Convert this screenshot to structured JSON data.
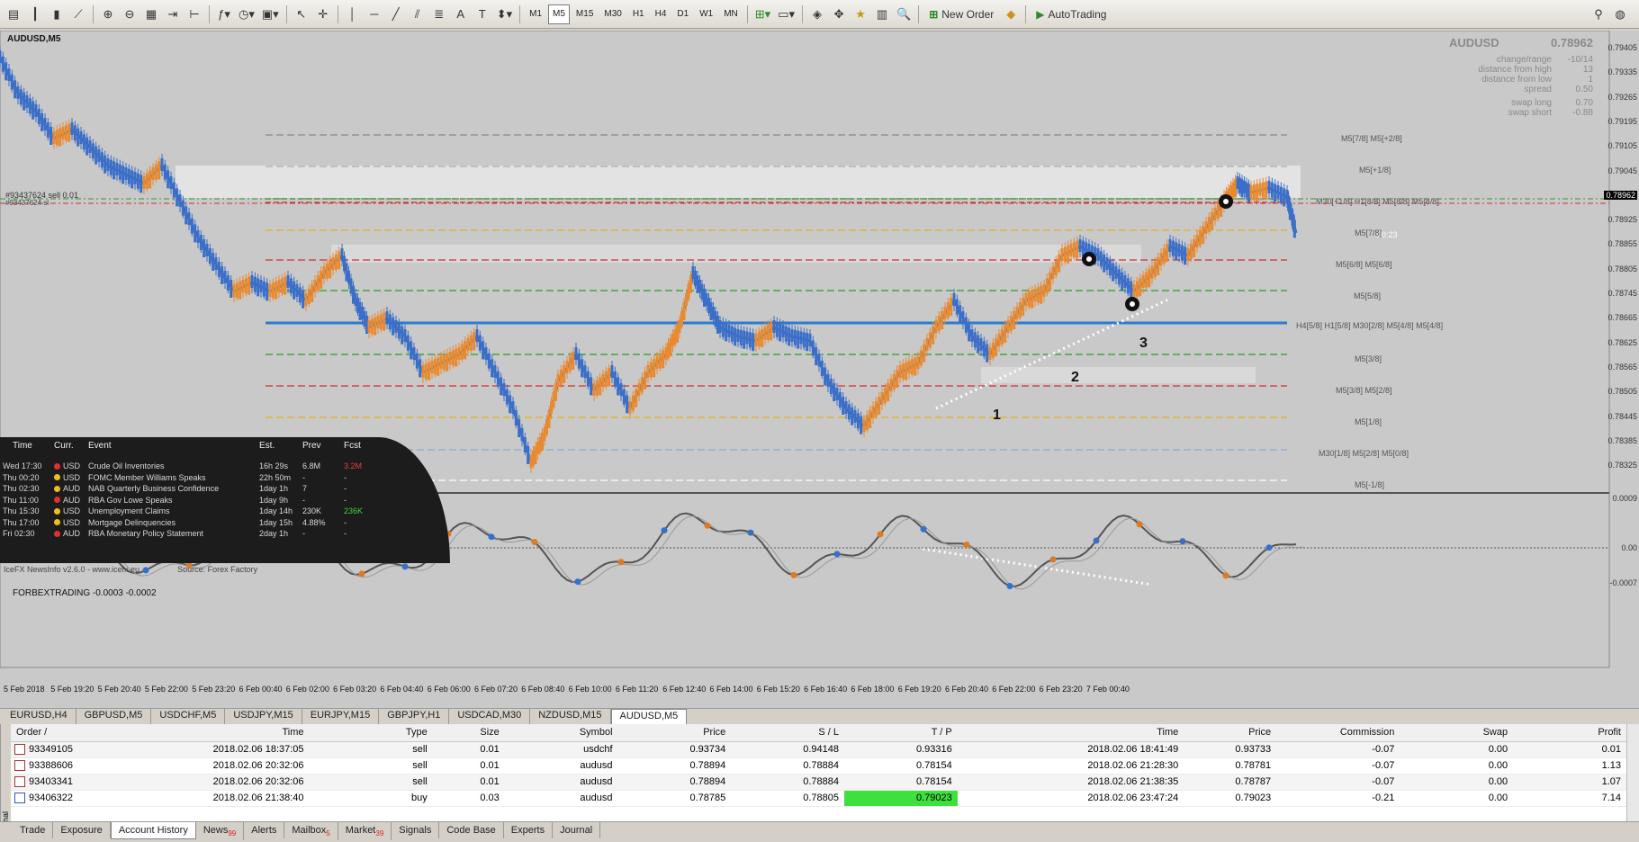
{
  "toolbar": {
    "timeframes": [
      "M1",
      "M5",
      "M15",
      "M30",
      "H1",
      "H4",
      "D1",
      "W1",
      "MN"
    ],
    "active_timeframe": "M5",
    "new_order_label": "New Order",
    "autotrading_label": "AutoTrading"
  },
  "chart": {
    "symbol_title": "AUDUSD,M5",
    "order_line_label": "#93437624 sell 0.01",
    "order_line_label2": "#93437624 sl",
    "price_axis": [
      "0.79405",
      "0.79335",
      "0.79265",
      "0.79195",
      "0.79105",
      "0.79045",
      "0.78962",
      "0.78925",
      "0.78855",
      "0.78805",
      "0.78745",
      "0.78665",
      "0.78625",
      "0.78565",
      "0.78505",
      "0.78445",
      "0.78385",
      "0.78325"
    ],
    "current_price": "0.78962",
    "countdown": "00:23",
    "info_box": {
      "symbol": "AUDUSD",
      "price": "0.78962",
      "rows": [
        {
          "label": "change/range",
          "value": "-10/14"
        },
        {
          "label": "distance from high",
          "value": "13"
        },
        {
          "label": "distance from low",
          "value": "1"
        },
        {
          "label": "spread",
          "value": "0.50"
        },
        {
          "label": "swap long",
          "value": "0.70"
        },
        {
          "label": "swap short",
          "value": "-0.88"
        }
      ]
    },
    "level_labels": [
      "M5[7/8] M5[+2/8]",
      "M5[+1/8]",
      "M30[+1/8] H1[8/8] M5[8/8] M5[8/8]",
      "M5[7/8]",
      "M5[6/8] M5[6/8]",
      "M5[5/8]",
      "H4[5/8] H1[5/8] M30[2/8] M5[4/8] M5[4/8]",
      "M5[3/8]",
      "M5[3/8] M5[2/8]",
      "M5[1/8]",
      "M30[1/8] M5[2/8] M5[0/8]",
      "M5[-1/8]"
    ],
    "annotations": [
      "1",
      "2",
      "3"
    ],
    "oscillator": {
      "title": "FORBEXTRADING -0.0003 -0.0002",
      "axis": [
        "0.0009",
        "0.00",
        "-0.0007"
      ]
    },
    "time_axis": [
      "5 Feb 2018",
      "5 Feb 19:20",
      "5 Feb 20:40",
      "5 Feb 22:00",
      "5 Feb 23:20",
      "6 Feb 00:40",
      "6 Feb 02:00",
      "6 Feb 03:20",
      "6 Feb 04:40",
      "6 Feb 06:00",
      "6 Feb 07:20",
      "6 Feb 08:40",
      "6 Feb 10:00",
      "6 Feb 11:20",
      "6 Feb 12:40",
      "6 Feb 14:00",
      "6 Feb 15:20",
      "6 Feb 16:40",
      "6 Feb 18:00",
      "6 Feb 19:20",
      "6 Feb 20:40",
      "6 Feb 22:00",
      "6 Feb 23:20",
      "7 Feb 00:40"
    ]
  },
  "news": {
    "headers": {
      "time": "Time",
      "curr": "Curr.",
      "event": "Event",
      "est": "Est.",
      "prev": "Prev",
      "fcst": "Fcst"
    },
    "rows": [
      {
        "time": "Wed 17:30",
        "curr": "USD",
        "color": "#e03030",
        "event": "Crude Oil Inventories",
        "est": "16h 29s",
        "prev": "6.8M",
        "fcst": "3.2M"
      },
      {
        "time": "Thu 00:20",
        "curr": "USD",
        "color": "#e8c020",
        "event": "FOMC Member Williams Speaks",
        "est": "22h 50m",
        "prev": "-",
        "fcst": "-"
      },
      {
        "time": "Thu 02:30",
        "curr": "AUD",
        "color": "#e8c020",
        "event": "NAB Quarterly Business Confidence",
        "est": "1day 1h",
        "prev": "7",
        "fcst": "-"
      },
      {
        "time": "Thu 11:00",
        "curr": "AUD",
        "color": "#e03030",
        "event": "RBA Gov Lowe Speaks",
        "est": "1day 9h",
        "prev": "-",
        "fcst": "-"
      },
      {
        "time": "Thu 15:30",
        "curr": "USD",
        "color": "#e8c020",
        "event": "Unemployment Claims",
        "est": "1day 14h",
        "prev": "230K",
        "fcst": "236K"
      },
      {
        "time": "Thu 17:00",
        "curr": "USD",
        "color": "#e8c020",
        "event": "Mortgage Delinquencies",
        "est": "1day 15h",
        "prev": "4.88%",
        "fcst": "-"
      },
      {
        "time": "Fri 02:30",
        "curr": "AUD",
        "color": "#e03030",
        "event": "RBA Monetary Policy Statement",
        "est": "2day 1h",
        "prev": "-",
        "fcst": "-"
      }
    ],
    "footer_left": "IceFX NewsInfo v2.6.0 - www.icefx.eu",
    "footer_right": "Source: Forex Factory"
  },
  "symbol_tabs": [
    "EURUSD,H4",
    "GBPUSD,M5",
    "USDCHF,M5",
    "USDJPY,M15",
    "EURJPY,M15",
    "GBPJPY,H1",
    "USDCAD,M30",
    "NZDUSD,M15",
    "AUDUSD,M5"
  ],
  "active_symbol_tab": "AUDUSD,M5",
  "orders": {
    "headers": [
      "Order",
      "Time",
      "Type",
      "Size",
      "Symbol",
      "Price",
      "S / L",
      "T / P",
      "Time",
      "Price",
      "Commission",
      "Swap",
      "Profit"
    ],
    "rows": [
      {
        "order": "93349105",
        "open_time": "2018.02.06 18:37:05",
        "type": "sell",
        "size": "0.01",
        "symbol": "usdchf",
        "price": "0.93734",
        "sl": "0.94148",
        "tp": "0.93316",
        "close_time": "2018.02.06 18:41:49",
        "close_price": "0.93733",
        "commission": "-0.07",
        "swap": "0.00",
        "profit": "0.01"
      },
      {
        "order": "93388606",
        "open_time": "2018.02.06 20:32:06",
        "type": "sell",
        "size": "0.01",
        "symbol": "audusd",
        "price": "0.78894",
        "sl": "0.78884",
        "tp": "0.78154",
        "close_time": "2018.02.06 21:28:30",
        "close_price": "0.78781",
        "commission": "-0.07",
        "swap": "0.00",
        "profit": "1.13"
      },
      {
        "order": "93403341",
        "open_time": "2018.02.06 20:32:06",
        "type": "sell",
        "size": "0.01",
        "symbol": "audusd",
        "price": "0.78894",
        "sl": "0.78884",
        "tp": "0.78154",
        "close_time": "2018.02.06 21:38:35",
        "close_price": "0.78787",
        "commission": "-0.07",
        "swap": "0.00",
        "profit": "1.07"
      },
      {
        "order": "93406322",
        "open_time": "2018.02.06 21:38:40",
        "type": "buy",
        "size": "0.03",
        "symbol": "audusd",
        "price": "0.78785",
        "sl": "0.78805",
        "tp": "0.79023",
        "close_time": "2018.02.06 23:47:24",
        "close_price": "0.79023",
        "commission": "-0.21",
        "swap": "0.00",
        "profit": "7.14"
      }
    ]
  },
  "bottom_tabs": [
    {
      "label": "Trade",
      "badge": ""
    },
    {
      "label": "Exposure",
      "badge": ""
    },
    {
      "label": "Account History",
      "badge": ""
    },
    {
      "label": "News",
      "badge": "99"
    },
    {
      "label": "Alerts",
      "badge": ""
    },
    {
      "label": "Mailbox",
      "badge": "5"
    },
    {
      "label": "Market",
      "badge": "39"
    },
    {
      "label": "Signals",
      "badge": ""
    },
    {
      "label": "Code Base",
      "badge": ""
    },
    {
      "label": "Experts",
      "badge": ""
    },
    {
      "label": "Journal",
      "badge": ""
    }
  ],
  "active_bottom_tab": "Account History",
  "terminal_label": "Terminal"
}
